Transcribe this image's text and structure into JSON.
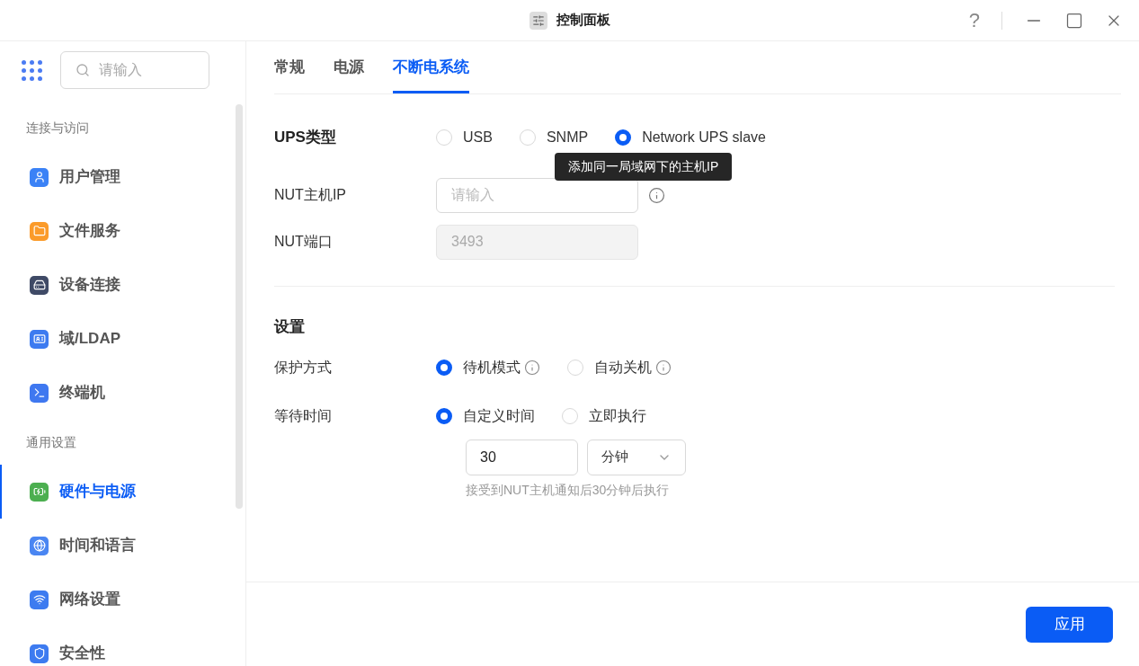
{
  "window": {
    "title": "控制面板",
    "help": "?"
  },
  "sidebar": {
    "search": {
      "placeholder": "请输入"
    },
    "groups": [
      {
        "title": "连接与访问",
        "items": [
          {
            "label": "用户管理",
            "selected": false
          },
          {
            "label": "文件服务",
            "selected": false
          },
          {
            "label": "设备连接",
            "selected": false
          },
          {
            "label": "域/LDAP",
            "selected": false
          },
          {
            "label": "终端机",
            "selected": false
          }
        ]
      },
      {
        "title": "通用设置",
        "items": [
          {
            "label": "硬件与电源",
            "selected": true
          },
          {
            "label": "时间和语言",
            "selected": false
          },
          {
            "label": "网络设置",
            "selected": false
          },
          {
            "label": "安全性",
            "selected": false
          }
        ]
      }
    ]
  },
  "tabs": [
    {
      "label": "常规",
      "selected": false
    },
    {
      "label": "电源",
      "selected": false
    },
    {
      "label": "不断电系统",
      "selected": true
    }
  ],
  "ups": {
    "title": "UPS类型",
    "options": [
      {
        "label": "USB",
        "selected": false
      },
      {
        "label": "SNMP",
        "selected": false
      },
      {
        "label": "Network UPS slave",
        "selected": true
      }
    ],
    "host_ip": {
      "label": "NUT主机IP",
      "placeholder": "请输入",
      "tooltip": "添加同一局域网下的主机IP"
    },
    "port": {
      "label": "NUT端口",
      "value": "3493",
      "disabled": true
    }
  },
  "settings": {
    "title": "设置",
    "protection": {
      "label": "保护方式",
      "options": [
        {
          "label": "待机模式",
          "selected": true
        },
        {
          "label": "自动关机",
          "selected": false
        }
      ]
    },
    "wait": {
      "label": "等待时间",
      "options": [
        {
          "label": "自定义时间",
          "selected": true
        },
        {
          "label": "立即执行",
          "selected": false
        }
      ],
      "value": "30",
      "unit": "分钟",
      "hint": "接受到NUT主机通知后30分钟后执行"
    }
  },
  "apply_button": "应用"
}
